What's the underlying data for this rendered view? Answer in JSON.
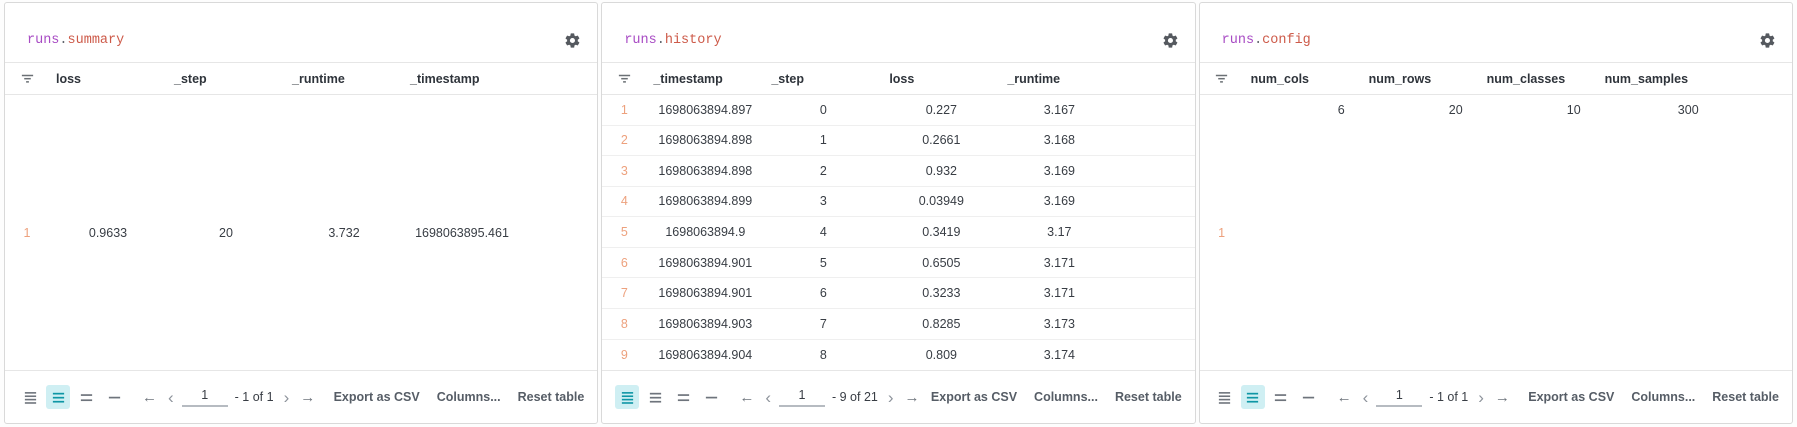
{
  "footer": {
    "nav": {
      "first_glyph": "←",
      "prev_glyph": "‹",
      "next_glyph": "›",
      "last_glyph": "→"
    },
    "actions": {
      "export": "Export as CSV",
      "columns": "Columns...",
      "reset": "Reset table"
    }
  },
  "colors": {
    "keyword_purple": "#a84bc4",
    "field_red": "#cd5a49",
    "row_index_orange": "#eda17d",
    "active_teal": "#0e96a5",
    "active_teal_bg": "#cfeff3"
  },
  "panels": [
    {
      "title_prefix": "runs",
      "title_dot": ".",
      "title_suffix": "summary",
      "columns": [
        "loss",
        "_step",
        "_runtime",
        "_timestamp"
      ],
      "rows": [
        {
          "index": "1",
          "values": [
            "0.9633",
            "20",
            "3.732",
            "1698063895.461"
          ]
        }
      ],
      "active_row_height": 1,
      "pagination": {
        "page": "1",
        "info": "- 1 of 1"
      }
    },
    {
      "title_prefix": "runs",
      "title_dot": ".",
      "title_suffix": "history",
      "columns": [
        "_timestamp",
        "_step",
        "loss",
        "_runtime"
      ],
      "rows": [
        {
          "index": "1",
          "values": [
            "1698063894.897",
            "0",
            "0.227",
            "3.167"
          ]
        },
        {
          "index": "2",
          "values": [
            "1698063894.898",
            "1",
            "0.2661",
            "3.168"
          ]
        },
        {
          "index": "3",
          "values": [
            "1698063894.898",
            "2",
            "0.932",
            "3.169"
          ]
        },
        {
          "index": "4",
          "values": [
            "1698063894.899",
            "3",
            "0.03949",
            "3.169"
          ]
        },
        {
          "index": "5",
          "values": [
            "1698063894.9",
            "4",
            "0.3419",
            "3.17"
          ]
        },
        {
          "index": "6",
          "values": [
            "1698063894.901",
            "5",
            "0.6505",
            "3.171"
          ]
        },
        {
          "index": "7",
          "values": [
            "1698063894.901",
            "6",
            "0.3233",
            "3.171"
          ]
        },
        {
          "index": "8",
          "values": [
            "1698063894.903",
            "7",
            "0.8285",
            "3.173"
          ]
        },
        {
          "index": "9",
          "values": [
            "1698063894.904",
            "8",
            "0.809",
            "3.174"
          ]
        }
      ],
      "active_row_height": 0,
      "pagination": {
        "page": "1",
        "info": "- 9 of 21"
      }
    },
    {
      "title_prefix": "runs",
      "title_dot": ".",
      "title_suffix": "config",
      "columns": [
        "num_cols",
        "num_rows",
        "num_classes",
        "num_samples"
      ],
      "rows": [
        {
          "index": "1",
          "values": [
            "6",
            "20",
            "10",
            "300"
          ]
        }
      ],
      "active_row_height": 1,
      "pagination": {
        "page": "1",
        "info": "- 1 of 1"
      }
    }
  ]
}
